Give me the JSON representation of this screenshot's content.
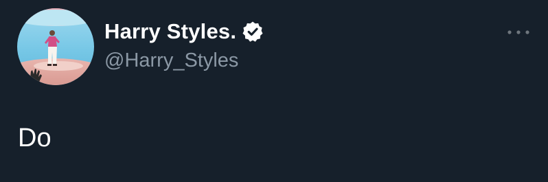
{
  "tweet": {
    "author": {
      "display_name": "Harry Styles.",
      "handle": "@Harry_Styles",
      "verified": true,
      "avatar_icon": "profile-photo"
    },
    "text": "Do",
    "more_icon": "more-horizontal-icon",
    "verified_icon": "verified-badge-icon"
  },
  "colors": {
    "background": "#16202b",
    "name": "#ffffff",
    "handle": "#8b98a5",
    "text": "#ffffff",
    "more_icon": "#6e767d"
  }
}
